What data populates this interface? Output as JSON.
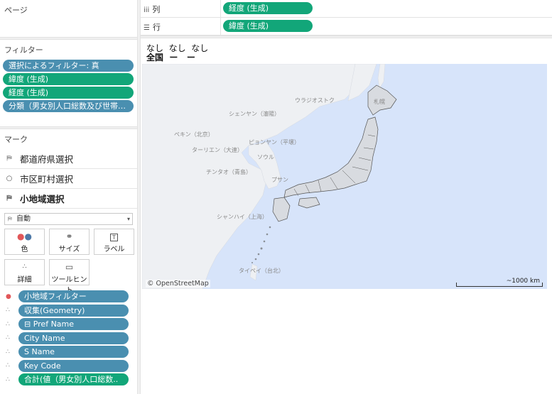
{
  "pages": {
    "title": "ページ"
  },
  "filters": {
    "title": "フィルター",
    "items": [
      "選択によるフィルター: 真",
      "緯度 (生成)",
      "経度 (生成)",
      "分類（男女別人口総数及び世帯数..."
    ]
  },
  "marks": {
    "title": "マーク",
    "layers": [
      "都道府県選択",
      "市区町村選択",
      "小地域選択"
    ],
    "mark_type": "自動",
    "buttons": [
      "色",
      "サイズ",
      "ラベル",
      "詳細",
      "ツールヒント"
    ],
    "fields": [
      "小地域フィルター",
      "収集(Geometry)",
      "⊟ Pref Name",
      "City Name",
      "S Name",
      "Key Code",
      "合計(値（男女別人口総数.."
    ]
  },
  "shelves": {
    "columns_label": "列",
    "columns_pill": "経度 (生成)",
    "rows_label": "行",
    "rows_pill": "緯度 (生成)"
  },
  "view": {
    "header_row1": "なし  なし  なし",
    "header_row2": "全国  ー   ー"
  },
  "map": {
    "cities": [
      "ウラジオストク",
      "シェンヤン（瀋陽）",
      "ペキン（北京）",
      "ピョンヤン（平壌）",
      "ターリエン（大連）",
      "ソウル",
      "チンタオ（青島）",
      "プサン",
      "シャンハイ（上海）",
      "タイペイ（台北）",
      "札幌"
    ],
    "attribution": "© OpenStreetMap",
    "scale_label": "~1000 km"
  },
  "colors": {
    "pill_blue": "#4a8fb0",
    "pill_green": "#12a679",
    "sea": "#d7e4fa",
    "land": "#eef0f3"
  }
}
